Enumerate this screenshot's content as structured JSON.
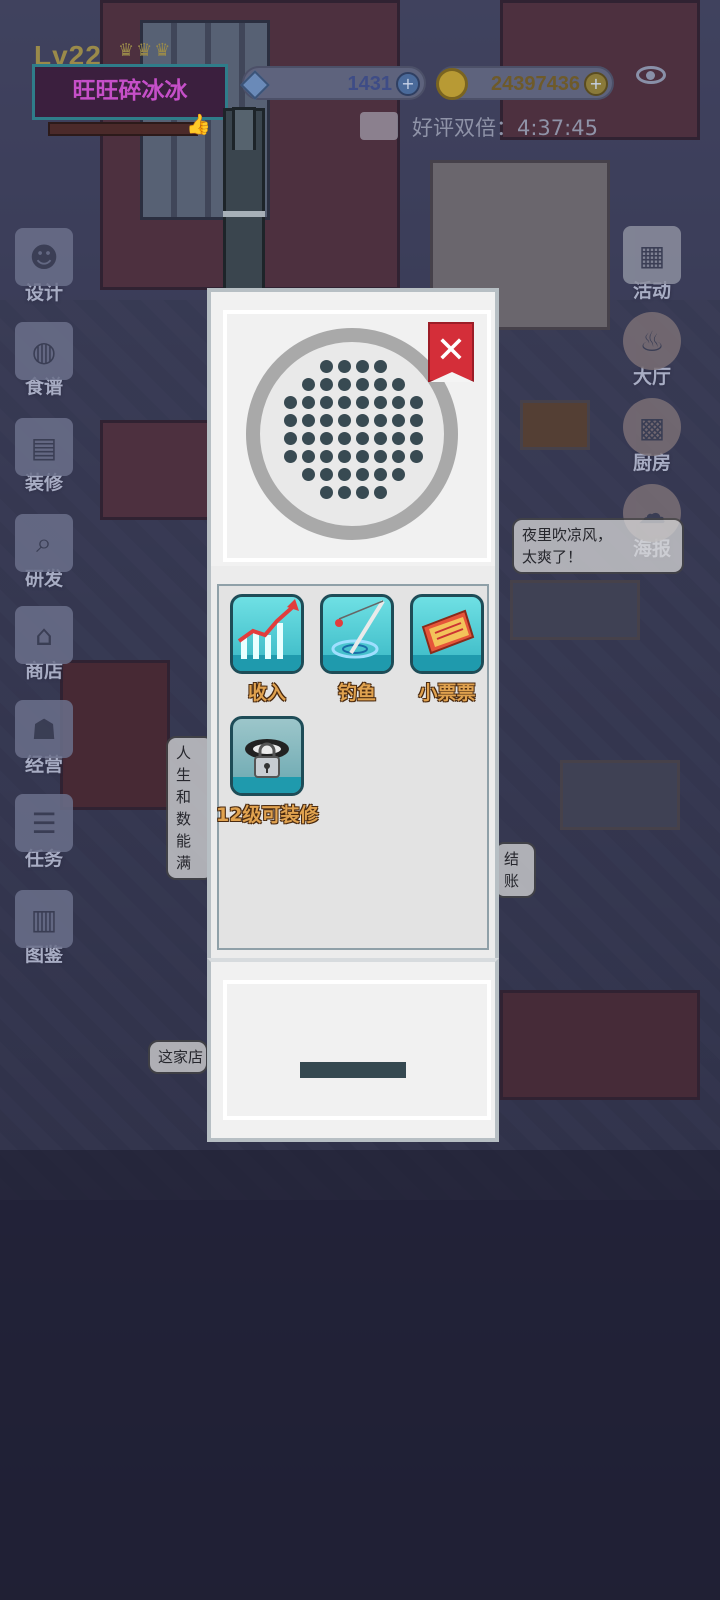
{
  "hud": {
    "level": "Lv22",
    "crowns": "♛♛♛",
    "restaurant_name": "旺旺碎冰冰",
    "gems": "1431",
    "coins": "24397436",
    "praise_label": "好评双倍：",
    "praise_timer": "4:37:45"
  },
  "left_menu": [
    {
      "label": "设计",
      "icon": "chef-hat-icon"
    },
    {
      "label": "食谱",
      "icon": "skewer-icon"
    },
    {
      "label": "装修",
      "icon": "table-icon"
    },
    {
      "label": "研发",
      "icon": "magnifier-icon"
    },
    {
      "label": "商店",
      "icon": "shop-icon"
    },
    {
      "label": "经营",
      "icon": "manage-icon"
    },
    {
      "label": "任务",
      "icon": "task-icon"
    },
    {
      "label": "图鉴",
      "icon": "book-icon"
    }
  ],
  "right_menu": [
    {
      "label": "活动",
      "icon": "calendar-icon"
    },
    {
      "label": "大厅",
      "icon": "hall-icon"
    },
    {
      "label": "厨房",
      "icon": "kitchen-icon"
    },
    {
      "label": "海报",
      "icon": "poster-icon"
    }
  ],
  "bubbles": {
    "customer1": "夜里吹凉风，\n太爽了！",
    "customer2": "人生\n和数\n能满",
    "checkout": "结账",
    "passerby": "这家店"
  },
  "phone": {
    "close_symbol": "✕",
    "apps": [
      {
        "label": "收入",
        "icon": "income-chart-icon"
      },
      {
        "label": "钓鱼",
        "icon": "fishing-rod-icon"
      },
      {
        "label": "小票票",
        "icon": "lottery-ticket-icon"
      },
      {
        "label": "12级可装修",
        "icon": "locked-phone-icon",
        "locked": true
      }
    ]
  },
  "colors": {
    "close_red": "#d42e39",
    "app_teal": "#38b7c4",
    "label_gold": "#e0a24f"
  }
}
